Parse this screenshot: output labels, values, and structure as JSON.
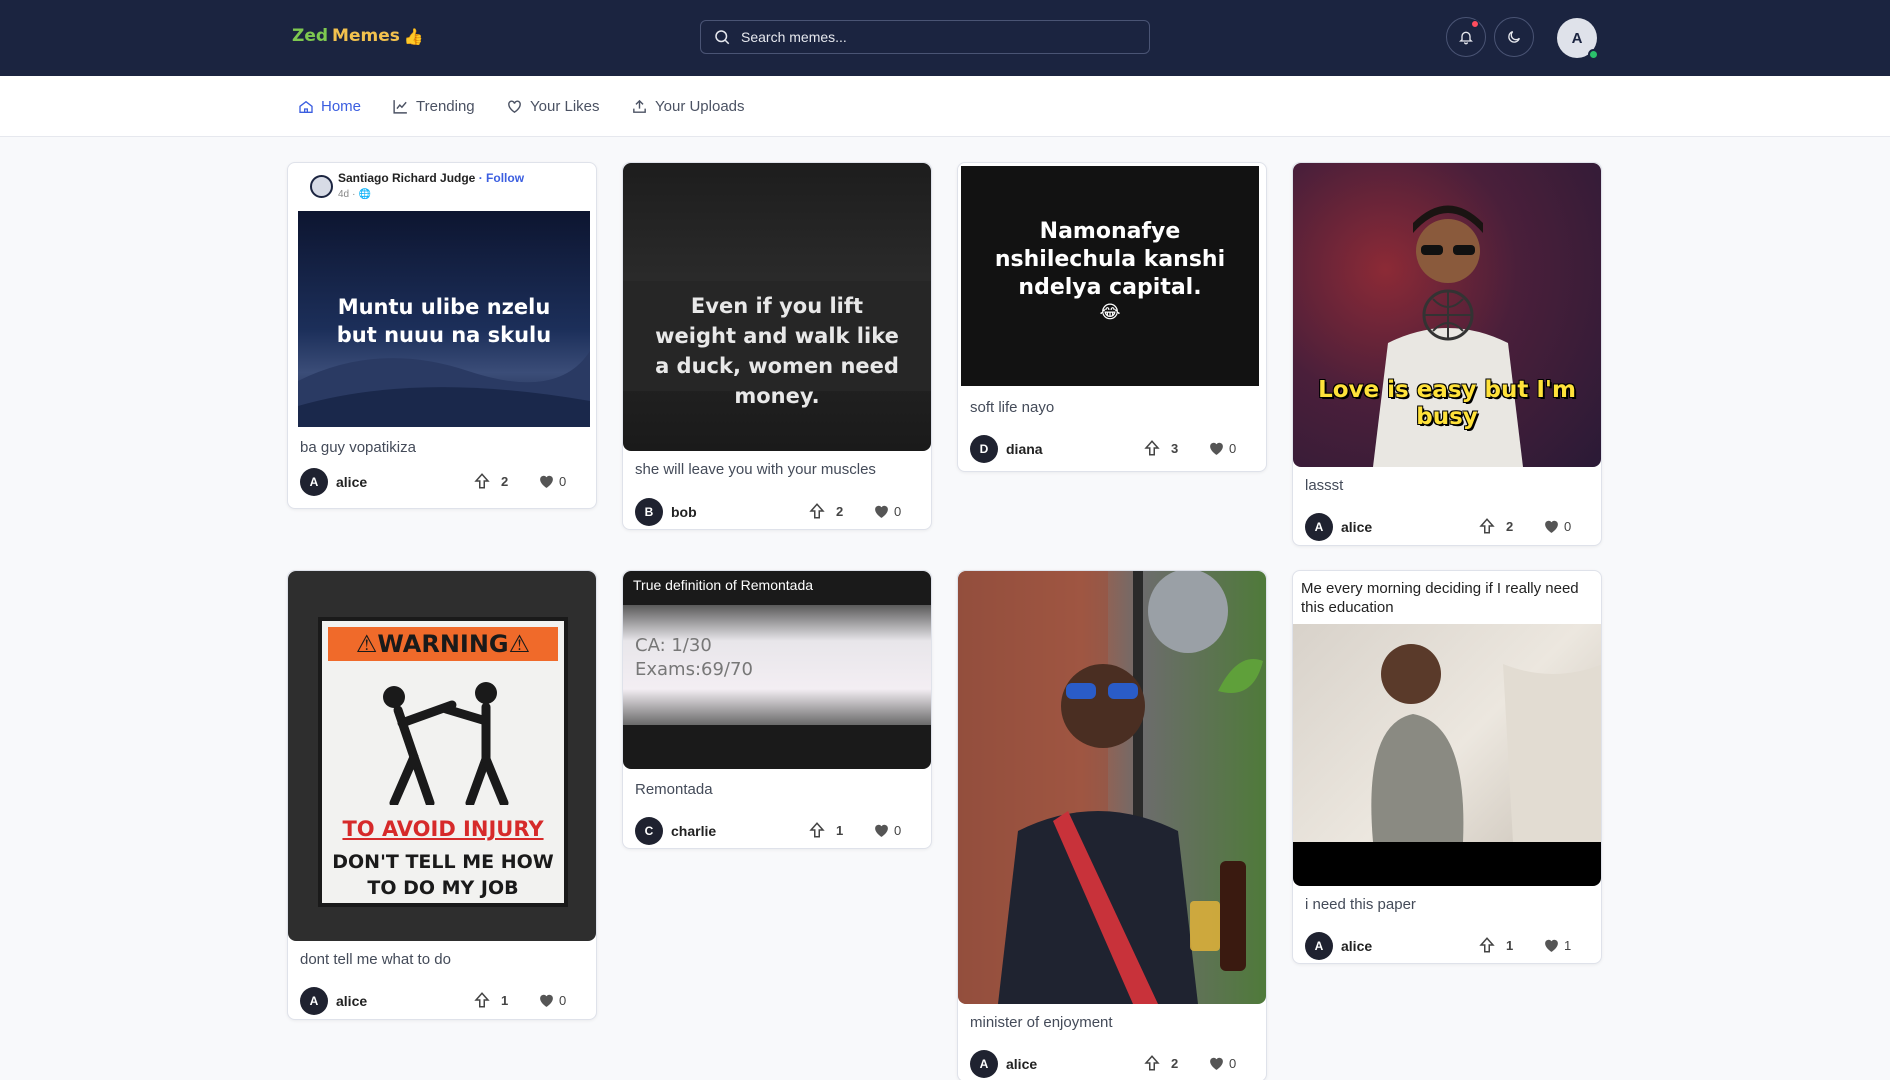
{
  "app": {
    "logo_part1": "Zed",
    "logo_part2": "Memes",
    "search_placeholder": "Search memes...",
    "user_initial": "A"
  },
  "nav": {
    "home": "Home",
    "trending": "Trending",
    "likes": "Your Likes",
    "uploads": "Your Uploads"
  },
  "colors": {
    "topbar": "#1b2440",
    "accent": "#3b5ee0",
    "notification_dot": "#ff4d5e",
    "online": "#2bc16b"
  },
  "cards": [
    {
      "caption": "ba guy vopatikiza",
      "user": "alice",
      "initial": "A",
      "votes": "2",
      "likes": "0",
      "fb_author": "Santiago Richard Judge",
      "fb_follow": "Follow",
      "fb_time": "4d",
      "meme_text": "Muntu ulibe nzelu but nuuu na skulu"
    },
    {
      "caption": "she will leave you with your muscles",
      "user": "bob",
      "initial": "B",
      "votes": "2",
      "likes": "0",
      "meme_text": "Even if you lift weight and walk like a duck, women need money."
    },
    {
      "caption": "soft life nayo",
      "user": "diana",
      "initial": "D",
      "votes": "3",
      "likes": "0",
      "meme_text": "Namonafye nshilechula kanshi ndelya capital.",
      "meme_emoji": "😂"
    },
    {
      "caption": "lassst",
      "user": "alice",
      "initial": "A",
      "votes": "2",
      "likes": "0",
      "meme_text": "Love is easy but I'm busy"
    },
    {
      "caption": "dont tell me what to do",
      "user": "alice",
      "initial": "A",
      "votes": "1",
      "likes": "0",
      "sign_header": "⚠WARNING⚠",
      "sign_line1": "TO AVOID INJURY",
      "sign_line2": "DON'T TELL ME HOW",
      "sign_line3": "TO DO MY JOB"
    },
    {
      "caption": "Remontada",
      "user": "charlie",
      "initial": "C",
      "votes": "1",
      "likes": "0",
      "meme_header": "True definition of Remontada",
      "score_ca": "CA: 1/30",
      "score_exams": "Exams:69/70"
    },
    {
      "caption": "minister of enjoyment",
      "user": "alice",
      "initial": "A",
      "votes": "2",
      "likes": "0"
    },
    {
      "caption": "i need this paper",
      "user": "alice",
      "initial": "A",
      "votes": "1",
      "likes": "1",
      "meme_header": "Me every morning deciding if I really need this education"
    }
  ]
}
